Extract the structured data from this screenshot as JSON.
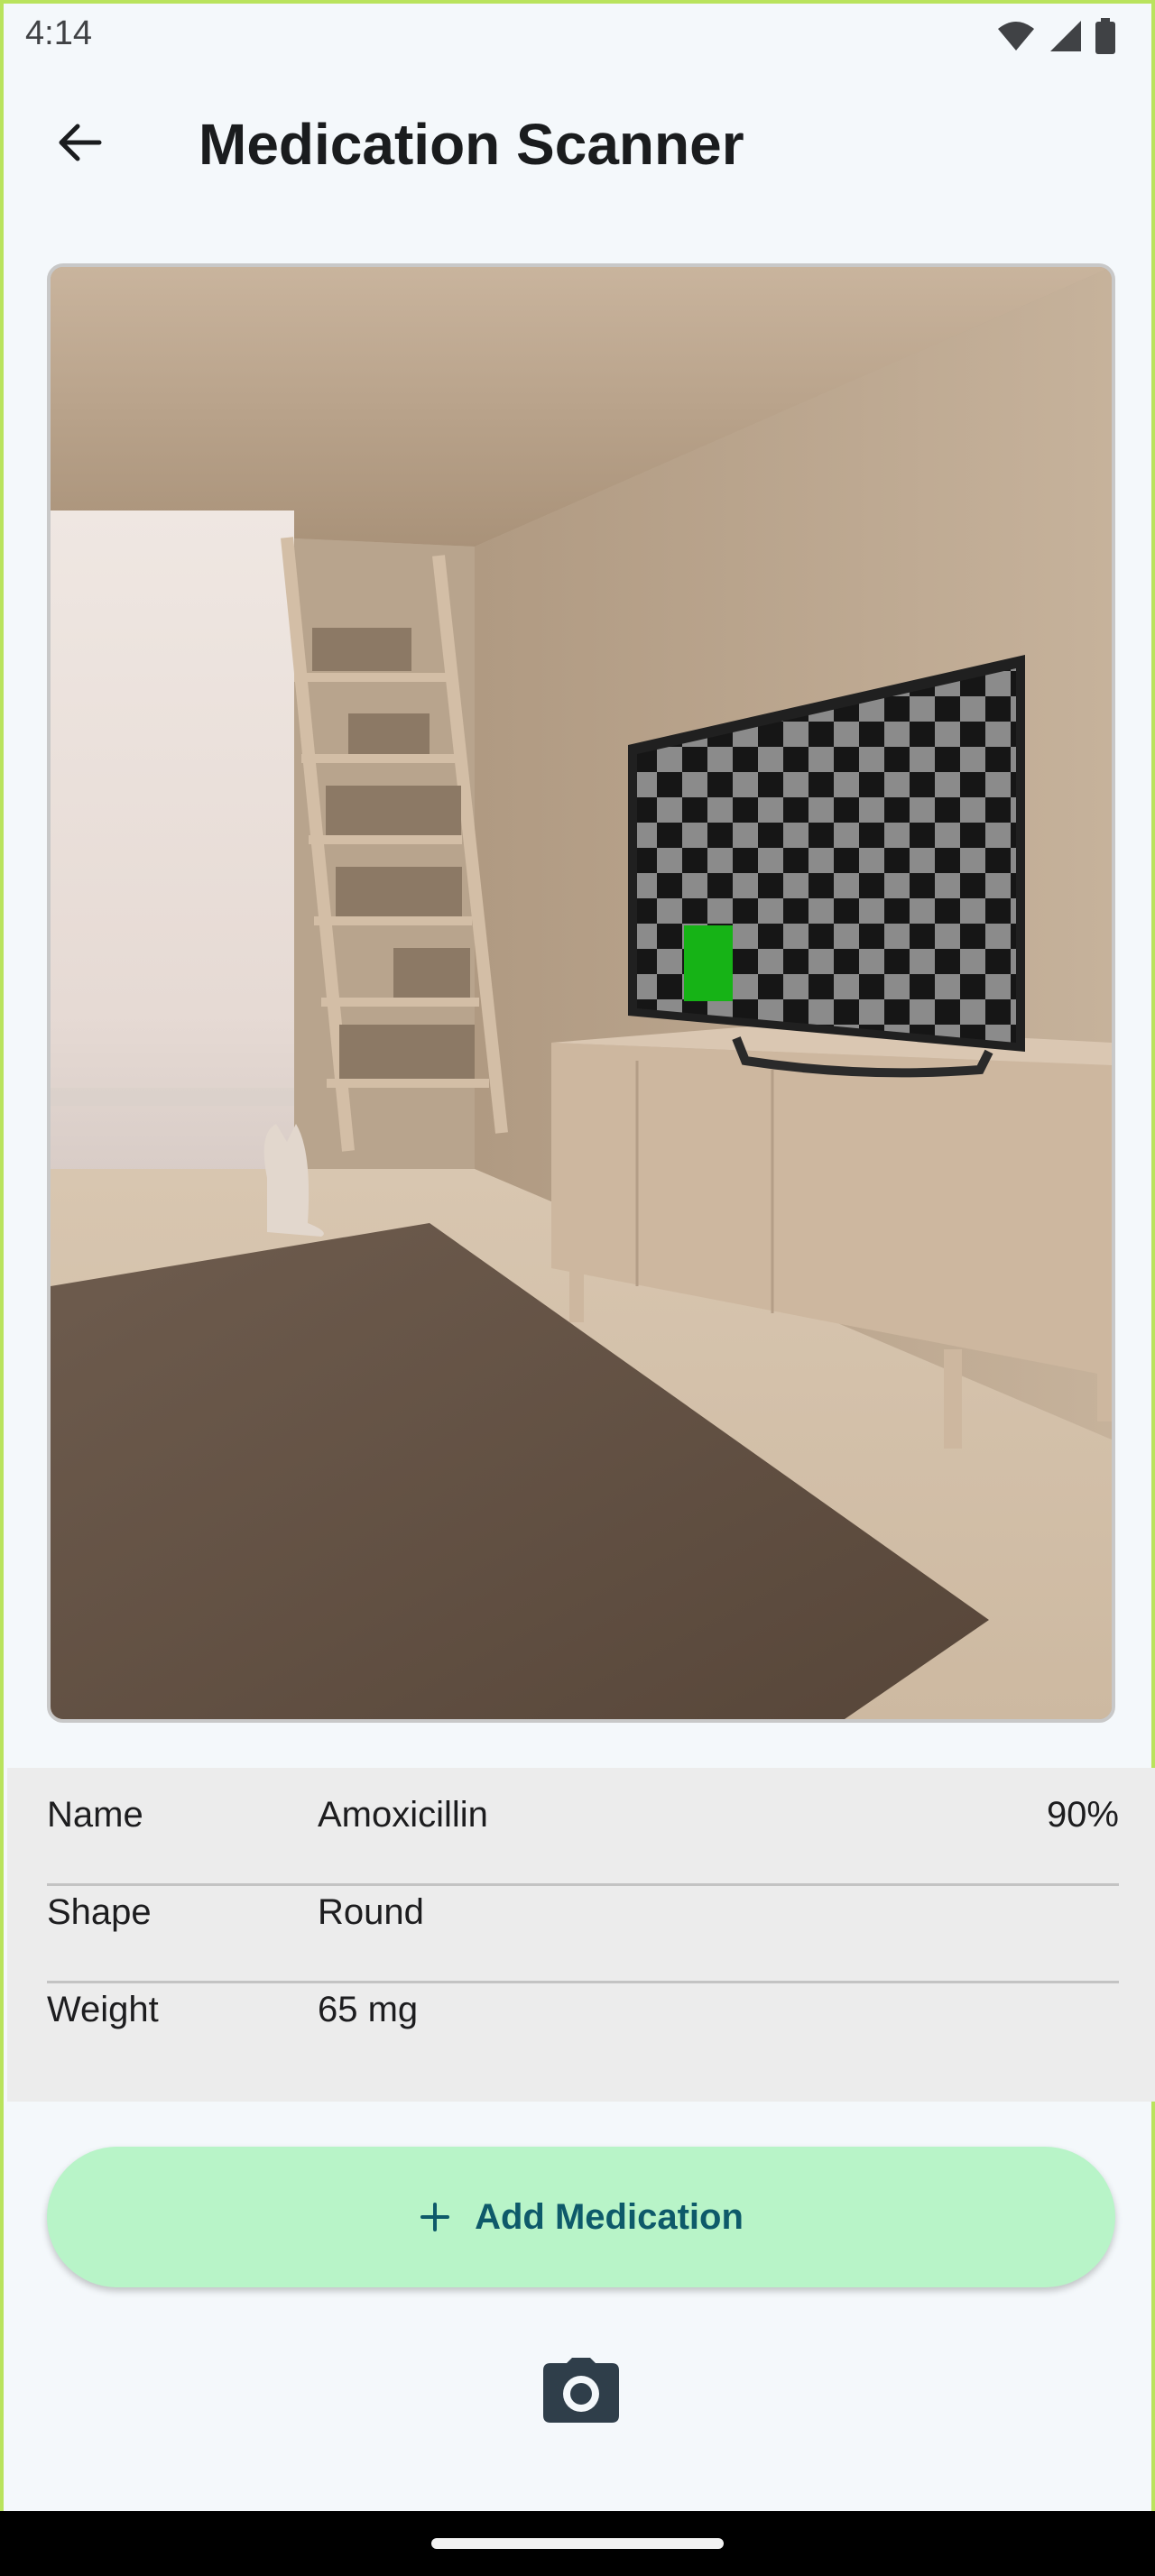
{
  "status_bar": {
    "time": "4:14",
    "icons": [
      "wifi-icon",
      "signal-icon",
      "battery-icon"
    ]
  },
  "app_bar": {
    "back_icon": "arrow-back-icon",
    "title": "Medication Scanner"
  },
  "scan_preview": {
    "description_icon": "camera-preview",
    "highlight_color": "#16b316"
  },
  "details": {
    "rows": [
      {
        "label": "Name",
        "value": "Amoxicillin",
        "confidence": "90%"
      },
      {
        "label": "Shape",
        "value": "Round"
      },
      {
        "label": "Weight",
        "value": "65 mg"
      }
    ]
  },
  "actions": {
    "add_label": "Add Medication",
    "add_icon": "plus-icon",
    "camera_icon": "camera-icon"
  },
  "colors": {
    "accent_button_bg": "#b8f4c8",
    "accent_button_text": "#0e5a6a",
    "frame_border": "#b9e35d"
  }
}
